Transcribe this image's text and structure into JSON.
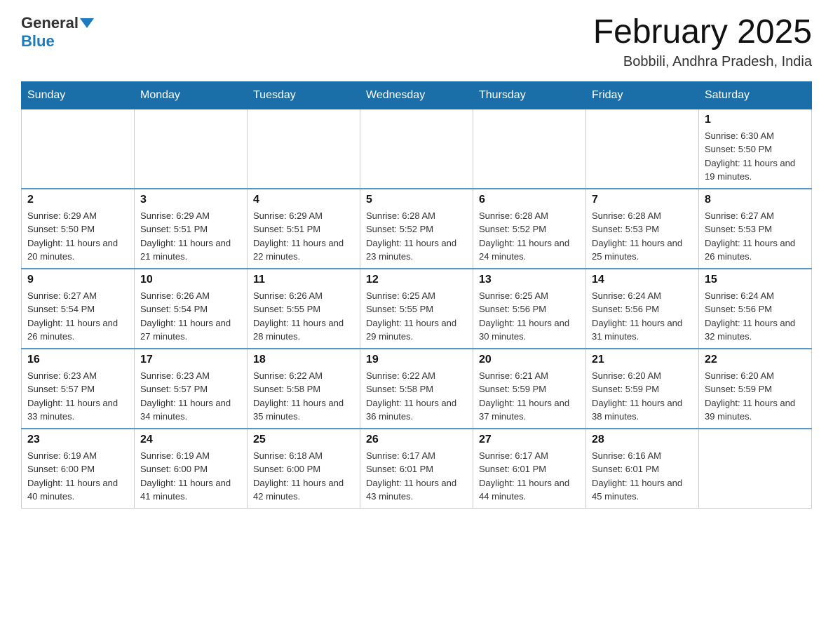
{
  "header": {
    "logo_general": "General",
    "logo_blue": "Blue",
    "month_title": "February 2025",
    "location": "Bobbili, Andhra Pradesh, India"
  },
  "days_of_week": [
    "Sunday",
    "Monday",
    "Tuesday",
    "Wednesday",
    "Thursday",
    "Friday",
    "Saturday"
  ],
  "weeks": [
    [
      {
        "day": "",
        "info": ""
      },
      {
        "day": "",
        "info": ""
      },
      {
        "day": "",
        "info": ""
      },
      {
        "day": "",
        "info": ""
      },
      {
        "day": "",
        "info": ""
      },
      {
        "day": "",
        "info": ""
      },
      {
        "day": "1",
        "info": "Sunrise: 6:30 AM\nSunset: 5:50 PM\nDaylight: 11 hours and 19 minutes."
      }
    ],
    [
      {
        "day": "2",
        "info": "Sunrise: 6:29 AM\nSunset: 5:50 PM\nDaylight: 11 hours and 20 minutes."
      },
      {
        "day": "3",
        "info": "Sunrise: 6:29 AM\nSunset: 5:51 PM\nDaylight: 11 hours and 21 minutes."
      },
      {
        "day": "4",
        "info": "Sunrise: 6:29 AM\nSunset: 5:51 PM\nDaylight: 11 hours and 22 minutes."
      },
      {
        "day": "5",
        "info": "Sunrise: 6:28 AM\nSunset: 5:52 PM\nDaylight: 11 hours and 23 minutes."
      },
      {
        "day": "6",
        "info": "Sunrise: 6:28 AM\nSunset: 5:52 PM\nDaylight: 11 hours and 24 minutes."
      },
      {
        "day": "7",
        "info": "Sunrise: 6:28 AM\nSunset: 5:53 PM\nDaylight: 11 hours and 25 minutes."
      },
      {
        "day": "8",
        "info": "Sunrise: 6:27 AM\nSunset: 5:53 PM\nDaylight: 11 hours and 26 minutes."
      }
    ],
    [
      {
        "day": "9",
        "info": "Sunrise: 6:27 AM\nSunset: 5:54 PM\nDaylight: 11 hours and 26 minutes."
      },
      {
        "day": "10",
        "info": "Sunrise: 6:26 AM\nSunset: 5:54 PM\nDaylight: 11 hours and 27 minutes."
      },
      {
        "day": "11",
        "info": "Sunrise: 6:26 AM\nSunset: 5:55 PM\nDaylight: 11 hours and 28 minutes."
      },
      {
        "day": "12",
        "info": "Sunrise: 6:25 AM\nSunset: 5:55 PM\nDaylight: 11 hours and 29 minutes."
      },
      {
        "day": "13",
        "info": "Sunrise: 6:25 AM\nSunset: 5:56 PM\nDaylight: 11 hours and 30 minutes."
      },
      {
        "day": "14",
        "info": "Sunrise: 6:24 AM\nSunset: 5:56 PM\nDaylight: 11 hours and 31 minutes."
      },
      {
        "day": "15",
        "info": "Sunrise: 6:24 AM\nSunset: 5:56 PM\nDaylight: 11 hours and 32 minutes."
      }
    ],
    [
      {
        "day": "16",
        "info": "Sunrise: 6:23 AM\nSunset: 5:57 PM\nDaylight: 11 hours and 33 minutes."
      },
      {
        "day": "17",
        "info": "Sunrise: 6:23 AM\nSunset: 5:57 PM\nDaylight: 11 hours and 34 minutes."
      },
      {
        "day": "18",
        "info": "Sunrise: 6:22 AM\nSunset: 5:58 PM\nDaylight: 11 hours and 35 minutes."
      },
      {
        "day": "19",
        "info": "Sunrise: 6:22 AM\nSunset: 5:58 PM\nDaylight: 11 hours and 36 minutes."
      },
      {
        "day": "20",
        "info": "Sunrise: 6:21 AM\nSunset: 5:59 PM\nDaylight: 11 hours and 37 minutes."
      },
      {
        "day": "21",
        "info": "Sunrise: 6:20 AM\nSunset: 5:59 PM\nDaylight: 11 hours and 38 minutes."
      },
      {
        "day": "22",
        "info": "Sunrise: 6:20 AM\nSunset: 5:59 PM\nDaylight: 11 hours and 39 minutes."
      }
    ],
    [
      {
        "day": "23",
        "info": "Sunrise: 6:19 AM\nSunset: 6:00 PM\nDaylight: 11 hours and 40 minutes."
      },
      {
        "day": "24",
        "info": "Sunrise: 6:19 AM\nSunset: 6:00 PM\nDaylight: 11 hours and 41 minutes."
      },
      {
        "day": "25",
        "info": "Sunrise: 6:18 AM\nSunset: 6:00 PM\nDaylight: 11 hours and 42 minutes."
      },
      {
        "day": "26",
        "info": "Sunrise: 6:17 AM\nSunset: 6:01 PM\nDaylight: 11 hours and 43 minutes."
      },
      {
        "day": "27",
        "info": "Sunrise: 6:17 AM\nSunset: 6:01 PM\nDaylight: 11 hours and 44 minutes."
      },
      {
        "day": "28",
        "info": "Sunrise: 6:16 AM\nSunset: 6:01 PM\nDaylight: 11 hours and 45 minutes."
      },
      {
        "day": "",
        "info": ""
      }
    ]
  ]
}
